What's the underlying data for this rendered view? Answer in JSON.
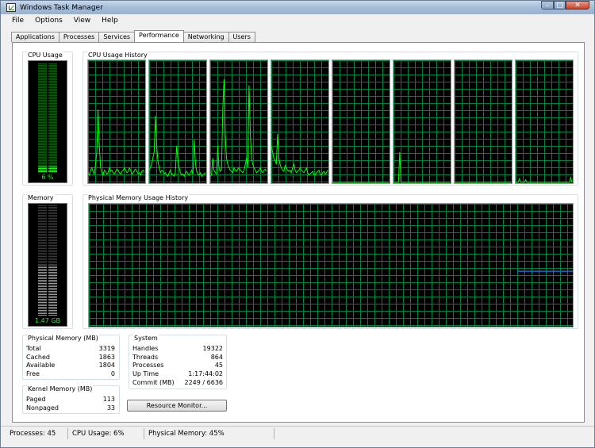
{
  "window": {
    "title": "Windows Task Manager"
  },
  "title_controls": {
    "minimize": "–",
    "maximize": "□",
    "close": "✕"
  },
  "menu": [
    "File",
    "Options",
    "View",
    "Help"
  ],
  "tabs": [
    "Applications",
    "Processes",
    "Services",
    "Performance",
    "Networking",
    "Users"
  ],
  "active_tab": "Performance",
  "cpu_usage": {
    "label": "CPU Usage",
    "value": "6 %",
    "percent": 6
  },
  "cpu_history": {
    "label": "CPU Usage History",
    "cores": [
      [
        8,
        6,
        10,
        12,
        9,
        7,
        15,
        25,
        60,
        30,
        12,
        8,
        6,
        10,
        9,
        7,
        8,
        12,
        9,
        10,
        8,
        7,
        9,
        11,
        10,
        8,
        7,
        9,
        10,
        12,
        10,
        8,
        9,
        12,
        10,
        7,
        8,
        10,
        11,
        9,
        7,
        8,
        6,
        9,
        10,
        8
      ],
      [
        10,
        12,
        15,
        20,
        25,
        55,
        30,
        18,
        12,
        8,
        10,
        9,
        7,
        8,
        6,
        5,
        8,
        10,
        7,
        6,
        5,
        9,
        30,
        18,
        12,
        8,
        6,
        7,
        5,
        8,
        9,
        7,
        6,
        8,
        10,
        7,
        35,
        15,
        9,
        7,
        6,
        8,
        5,
        6,
        7,
        8
      ],
      [
        5,
        6,
        20,
        10,
        8,
        7,
        30,
        12,
        9,
        10,
        60,
        85,
        40,
        20,
        15,
        12,
        10,
        9,
        8,
        12,
        10,
        9,
        11,
        12,
        10,
        9,
        8,
        10,
        15,
        20,
        12,
        80,
        40,
        20,
        15,
        12,
        10,
        8,
        9,
        10,
        12,
        9,
        8,
        10,
        11,
        9
      ],
      [
        30,
        25,
        20,
        18,
        15,
        40,
        20,
        15,
        12,
        10,
        9,
        14,
        12,
        10,
        9,
        10,
        8,
        12,
        15,
        10,
        8,
        9,
        10,
        12,
        10,
        9,
        8,
        10,
        12,
        8,
        6,
        7,
        8,
        9,
        7,
        6,
        8,
        9,
        10,
        7,
        6,
        8,
        9,
        7,
        8,
        10
      ],
      [
        0,
        0,
        0,
        0,
        0,
        0,
        0,
        0,
        0,
        0,
        0,
        0,
        0,
        0,
        0,
        0,
        0,
        0,
        0,
        0,
        0,
        0,
        0,
        0,
        0,
        0,
        0,
        0,
        0,
        0,
        0,
        0,
        0,
        0,
        0,
        0,
        0,
        0,
        0,
        0,
        0,
        0,
        0,
        0,
        0,
        0
      ],
      [
        0,
        0,
        0,
        0,
        0,
        25,
        0,
        0,
        0,
        0,
        0,
        0,
        0,
        0,
        0,
        0,
        0,
        0,
        0,
        0,
        0,
        0,
        0,
        0,
        0,
        0,
        0,
        0,
        0,
        0,
        0,
        0,
        0,
        0,
        0,
        0,
        0,
        0,
        0,
        0,
        0,
        0,
        0,
        0,
        0,
        0
      ],
      [
        0,
        0,
        0,
        0,
        0,
        0,
        0,
        0,
        0,
        0,
        0,
        0,
        0,
        0,
        0,
        0,
        0,
        0,
        0,
        0,
        0,
        0,
        0,
        0,
        0,
        0,
        0,
        0,
        0,
        0,
        0,
        0,
        0,
        0,
        0,
        0,
        0,
        0,
        0,
        0,
        0,
        0,
        0,
        0,
        0,
        0
      ],
      [
        0,
        0,
        0,
        3,
        0,
        0,
        0,
        0,
        2,
        0,
        0,
        0,
        0,
        0,
        0,
        0,
        0,
        0,
        0,
        0,
        0,
        0,
        0,
        0,
        0,
        0,
        0,
        0,
        0,
        0,
        0,
        0,
        0,
        0,
        0,
        0,
        0,
        0,
        0,
        0,
        0,
        0,
        0,
        0,
        4,
        0
      ]
    ]
  },
  "memory": {
    "label": "Memory",
    "value": "1.47 GB",
    "percent": 45
  },
  "memory_history": {
    "label": "Physical Memory Usage History",
    "percent": 45
  },
  "physical_memory": {
    "label": "Physical Memory (MB)",
    "rows": [
      {
        "name": "Total",
        "value": "3319"
      },
      {
        "name": "Cached",
        "value": "1863"
      },
      {
        "name": "Available",
        "value": "1804"
      },
      {
        "name": "Free",
        "value": "0"
      }
    ]
  },
  "kernel_memory": {
    "label": "Kernel Memory (MB)",
    "rows": [
      {
        "name": "Paged",
        "value": "113"
      },
      {
        "name": "Nonpaged",
        "value": "33"
      }
    ]
  },
  "system": {
    "label": "System",
    "rows": [
      {
        "name": "Handles",
        "value": "19322"
      },
      {
        "name": "Threads",
        "value": "864"
      },
      {
        "name": "Processes",
        "value": "45"
      },
      {
        "name": "Up Time",
        "value": "1:17:44:02"
      },
      {
        "name": "Commit (MB)",
        "value": "2249 / 6636"
      }
    ]
  },
  "resource_monitor_button": "Resource Monitor...",
  "status_bar": {
    "processes": "Processes: 45",
    "cpu": "CPU Usage: 6%",
    "memory": "Physical Memory: 45%"
  },
  "colors": {
    "graph_background": "#000000",
    "graph_grid": "#008040",
    "graph_line": "#00ff00",
    "memory_line": "#1e78ff",
    "meter_on": "#2fe62f",
    "meter_off": "#0f5a0f"
  }
}
